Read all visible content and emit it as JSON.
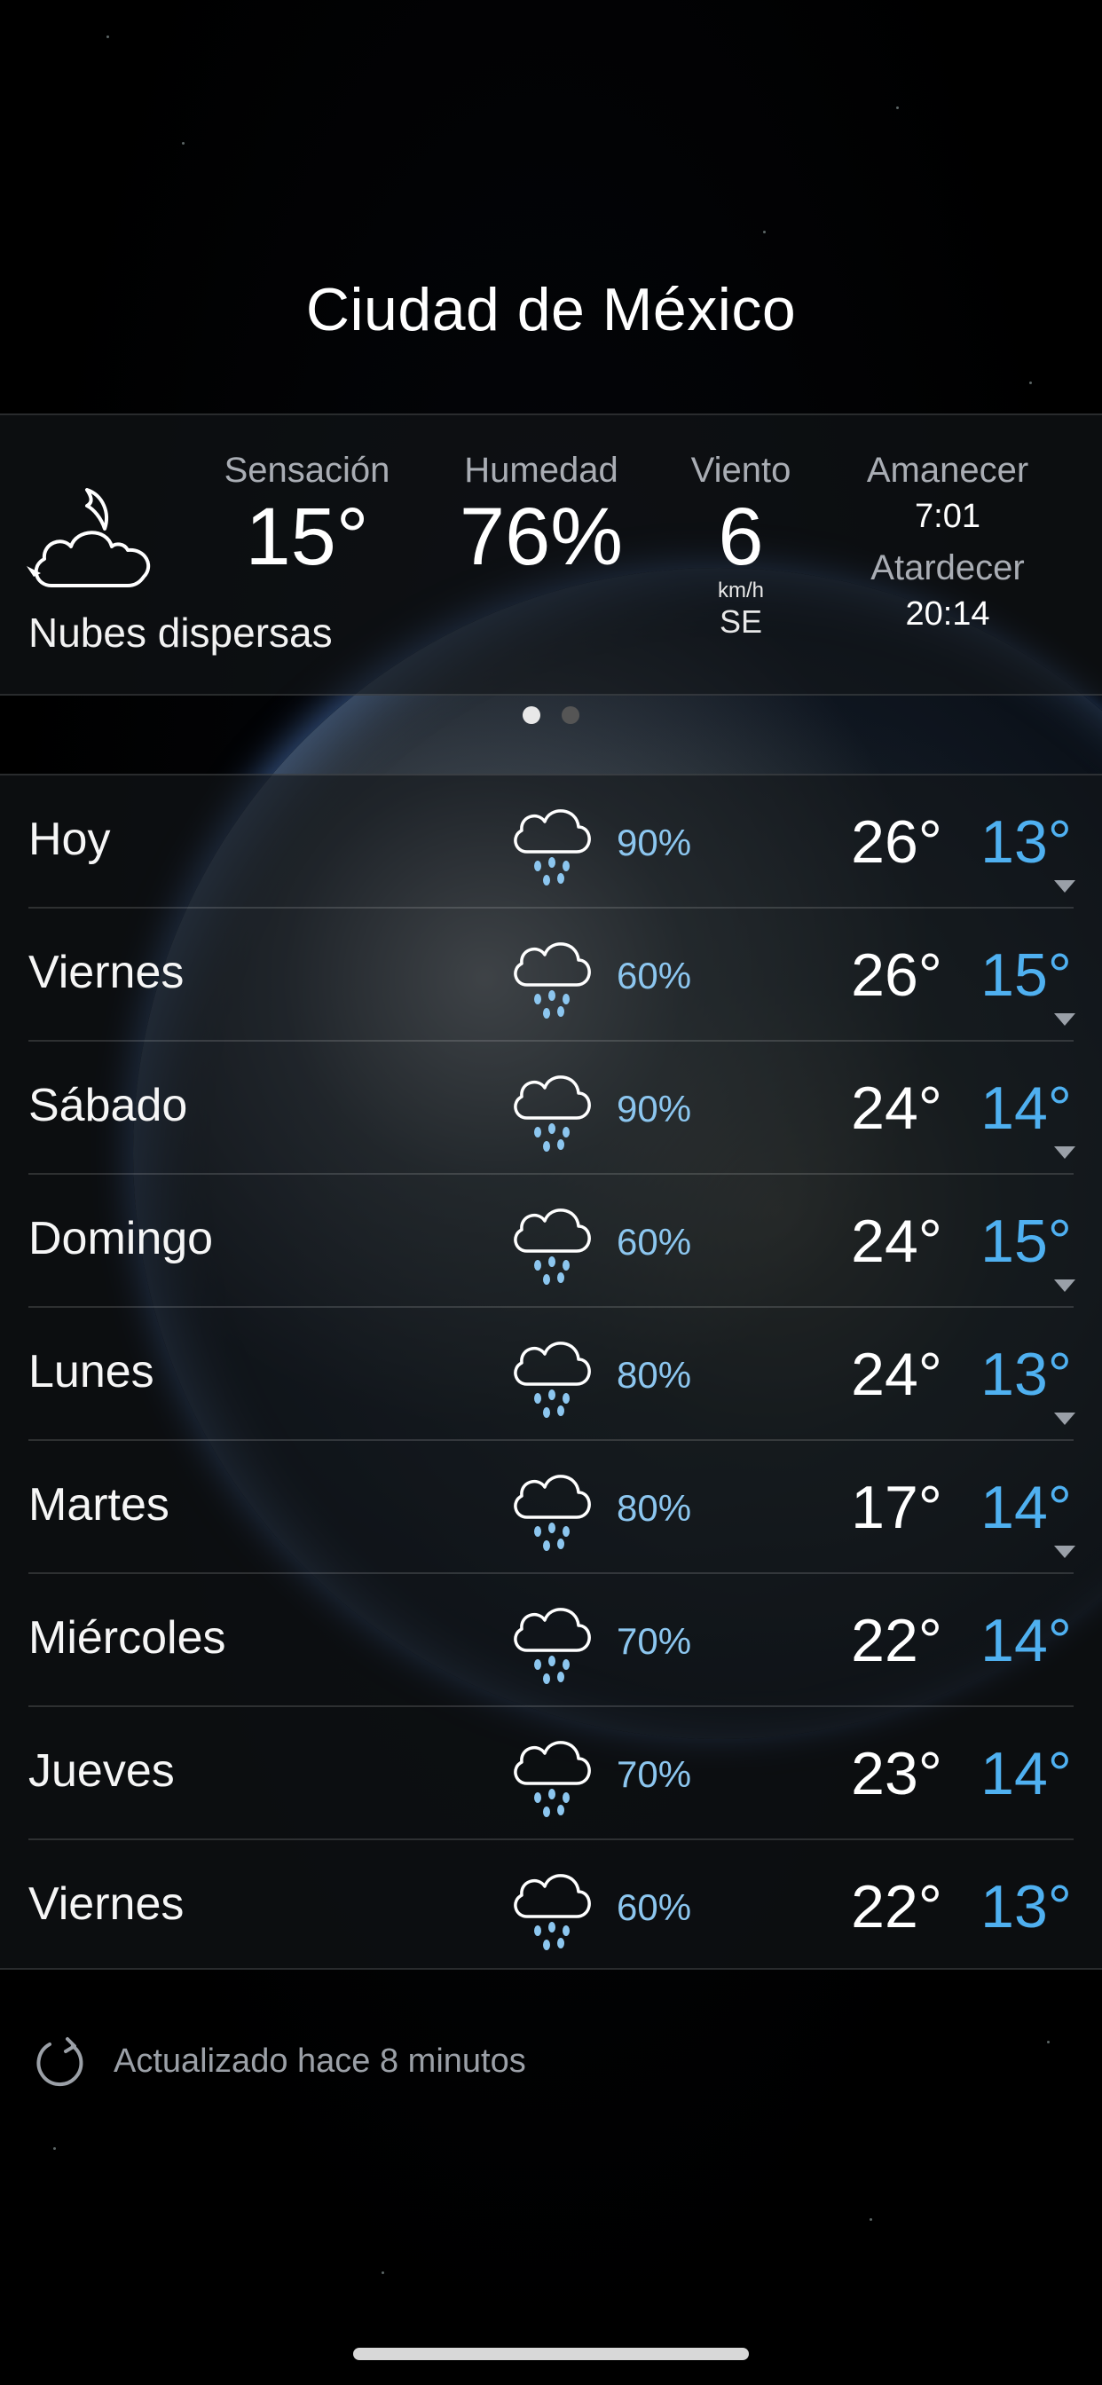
{
  "city": "Ciudad de México",
  "current": {
    "condition": "Nubes dispersas",
    "icon": "moon-cloud-icon",
    "feels_like": {
      "label": "Sensación",
      "value": "15°"
    },
    "humidity": {
      "label": "Humedad",
      "value": "76%"
    },
    "wind": {
      "label": "Viento",
      "value": "6",
      "unit": "km/h",
      "direction": "SE"
    },
    "sunrise": {
      "label": "Amanecer",
      "time": "7:01"
    },
    "sunset": {
      "label": "Atardecer",
      "time": "20:14"
    }
  },
  "pager": {
    "pages": 2,
    "active": 0
  },
  "forecast": [
    {
      "day": "Hoy",
      "precip": "90%",
      "high": "26°",
      "low": "13°",
      "expandable": true
    },
    {
      "day": "Viernes",
      "precip": "60%",
      "high": "26°",
      "low": "15°",
      "expandable": true
    },
    {
      "day": "Sábado",
      "precip": "90%",
      "high": "24°",
      "low": "14°",
      "expandable": true
    },
    {
      "day": "Domingo",
      "precip": "60%",
      "high": "24°",
      "low": "15°",
      "expandable": true
    },
    {
      "day": "Lunes",
      "precip": "80%",
      "high": "24°",
      "low": "13°",
      "expandable": true
    },
    {
      "day": "Martes",
      "precip": "80%",
      "high": "17°",
      "low": "14°",
      "expandable": true
    },
    {
      "day": "Miércoles",
      "precip": "70%",
      "high": "22°",
      "low": "14°",
      "expandable": false
    },
    {
      "day": "Jueves",
      "precip": "70%",
      "high": "23°",
      "low": "14°",
      "expandable": false
    },
    {
      "day": "Viernes",
      "precip": "60%",
      "high": "22°",
      "low": "13°",
      "expandable": false
    }
  ],
  "forecast_icon": "rain-cloud-icon",
  "updated": "Actualizado hace 8 minutos",
  "colors": {
    "low_temp": "#4fb0f0",
    "precip": "#8cc6ef",
    "background": "#000000"
  }
}
